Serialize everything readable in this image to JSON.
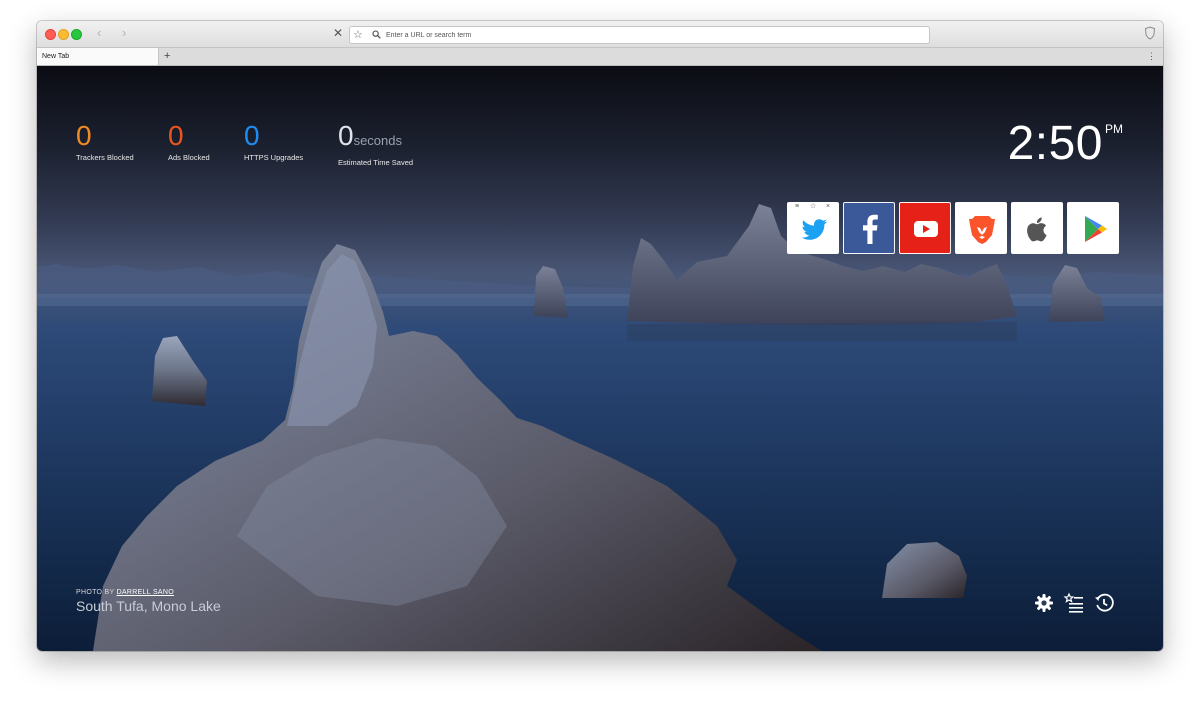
{
  "browser": {
    "url_placeholder": "Enter a URL or search term",
    "tab_label": "New Tab",
    "new_tab_symbol": "+",
    "menu_symbol": "⋮"
  },
  "stats": [
    {
      "value": "0",
      "label": "Trackers Blocked",
      "color": "#f08a24"
    },
    {
      "value": "0",
      "label": "Ads Blocked",
      "color": "#e8551f"
    },
    {
      "value": "0",
      "label": "HTTPS Upgrades",
      "color": "#1f8cf0"
    },
    {
      "value": "0",
      "unit": "seconds",
      "label": "Estimated Time Saved",
      "color": "#dfe2e8"
    }
  ],
  "clock": {
    "time": "2:50",
    "ampm": "PM"
  },
  "top_sites": [
    {
      "name": "twitter-icon",
      "bg": "#ffffff",
      "fg": "#1da1f2"
    },
    {
      "name": "facebook-icon",
      "bg": "#3b5998",
      "fg": "#ffffff"
    },
    {
      "name": "youtube-icon",
      "bg": "#e62117",
      "fg": "#ffffff"
    },
    {
      "name": "brave-lion-icon",
      "bg": "#ffffff",
      "fg": "#fb542b"
    },
    {
      "name": "apple-icon",
      "bg": "#ffffff",
      "fg": "#555555"
    },
    {
      "name": "google-play-icon",
      "bg": "#ffffff",
      "fg": "#34a853"
    }
  ],
  "tile_controls": {
    "drag": "≡",
    "pin": "☆",
    "remove": "×"
  },
  "photo": {
    "credit_prefix": "PHOTO BY",
    "credit_name": "DARRELL SANO",
    "location": "South Tufa, Mono Lake"
  },
  "footer_icons": [
    "settings-gear-icon",
    "bookmarks-icon",
    "history-clock-icon"
  ]
}
